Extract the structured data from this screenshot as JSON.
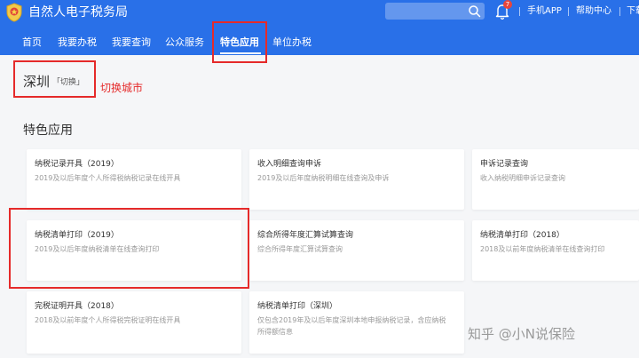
{
  "header": {
    "title": "自然人电子税务局",
    "search": {
      "value": "",
      "placeholder": ""
    },
    "notification_count": "7",
    "links": [
      "手机APP",
      "帮助中心",
      "下载"
    ]
  },
  "nav": {
    "items": [
      "首页",
      "我要办税",
      "我要查询",
      "公众服务",
      "特色应用",
      "单位办税"
    ],
    "active": "特色应用"
  },
  "city": {
    "name": "深圳",
    "switch_label": "「切换」"
  },
  "annotation": "切换城市",
  "section_title": "特色应用",
  "cards": [
    {
      "title": "纳税记录开具（2019）",
      "desc": "2019及以后年度个人所得税纳税记录在线开具"
    },
    {
      "title": "收入明细查询申诉",
      "desc": "2019及以后年度纳税明细在线查询及申诉"
    },
    {
      "title": "申诉记录查询",
      "desc": "收入纳税明细申诉记录查询"
    },
    {
      "title": "纳税清单打印（2019）",
      "desc": "2019及以后年度纳税清单在线查询打印"
    },
    {
      "title": "综合所得年度汇算试算查询",
      "desc": "综合所得年度汇算试算查询"
    },
    {
      "title": "纳税清单打印（2018）",
      "desc": "2018及以前年度纳税清单在线查询打印"
    },
    {
      "title": "完税证明开具（2018）",
      "desc": "2018及以前年度个人所得税完税证明在线开具"
    },
    {
      "title": "纳税清单打印（深圳）",
      "desc": "仅包含2019年及以后年度深圳本地申报纳税记录，含应纳税所得额信息"
    }
  ],
  "watermark": "知乎 @小Ν说保险",
  "colors": {
    "header_bg": "#2970e8",
    "annotation_red": "#e52a2a",
    "page_bg": "#f5f6f8"
  }
}
